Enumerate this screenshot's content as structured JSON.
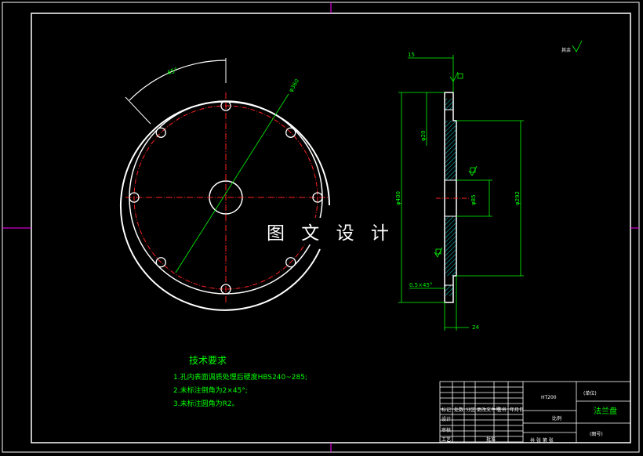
{
  "drawing": {
    "watermark": "图 文 设 计",
    "angle_label": "45°",
    "bolt_circle_label": "φ360",
    "hole_label": "φ20",
    "thickness_label": "15",
    "width_label": "24",
    "outer_dia_label": "φ400",
    "hub_dia_label": "φ292",
    "bore_dia_label": "φ85",
    "chamfer_label": "0.5×45°",
    "roughness_label": "其余"
  },
  "requirements": {
    "title": "技术要求",
    "items": [
      "1.孔内表面调质处理后硬度HBS240~285;",
      "2.未标注倒角为2×45°;",
      "3.未标注圆角为R2。"
    ]
  },
  "title_block": {
    "part_name": "法兰盘",
    "material": "HT200",
    "drawing_no": "(图号)",
    "unit": "(单位)",
    "scale_label": "比例",
    "sheet_label": "共 张 第 张",
    "row_labels": [
      "标记",
      "处数",
      "分区",
      "更改文件号",
      "签名",
      "年月日"
    ],
    "design_label": "设计",
    "check_label": "审核",
    "process_label": "工艺",
    "approve_label": "批准"
  }
}
